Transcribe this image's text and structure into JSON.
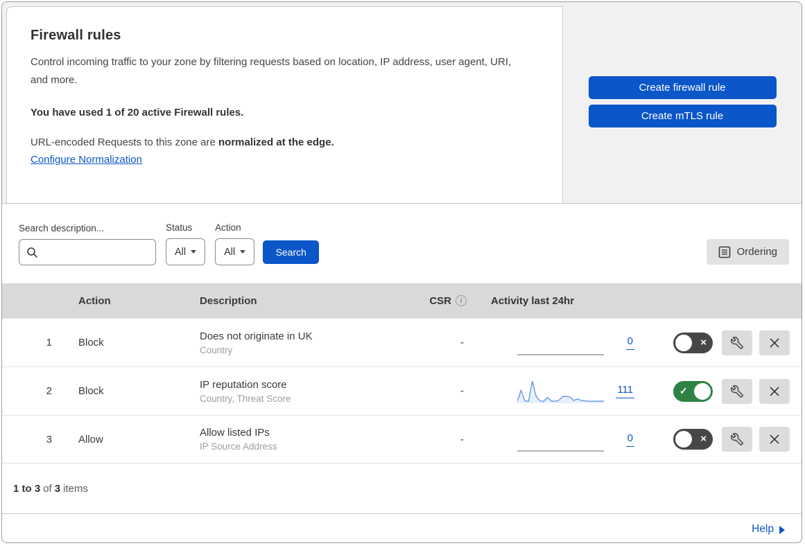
{
  "header": {
    "title": "Firewall rules",
    "description": "Control incoming traffic to your zone by filtering requests based on location, IP address, user agent, URI, and more.",
    "usage": "You have used 1 of 20 active Firewall rules.",
    "normalization_prefix": "URL-encoded Requests to this zone are ",
    "normalization_bold": "normalized at the edge.",
    "configure_link": "Configure Normalization",
    "create_firewall_btn": "Create firewall rule",
    "create_mtls_btn": "Create mTLS rule"
  },
  "filters": {
    "search_label": "Search description...",
    "search_value": "",
    "status_label": "Status",
    "status_value": "All",
    "action_label": "Action",
    "action_value": "All",
    "search_btn": "Search",
    "ordering_btn": "Ordering"
  },
  "table": {
    "columns": {
      "action": "Action",
      "description": "Description",
      "csr": "CSR",
      "activity": "Activity last 24hr"
    },
    "rows": [
      {
        "priority": "1",
        "action": "Block",
        "description": "Does not originate in UK",
        "criteria": "Country",
        "csr": "-",
        "activity_count": "0",
        "enabled": false
      },
      {
        "priority": "2",
        "action": "Block",
        "description": "IP reputation score",
        "criteria": "Country, Threat Score",
        "csr": "-",
        "activity_count": "111",
        "enabled": true
      },
      {
        "priority": "3",
        "action": "Allow",
        "description": "Allow listed IPs",
        "criteria": "IP Source Address",
        "csr": "-",
        "activity_count": "0",
        "enabled": false
      }
    ],
    "pagination": {
      "range": "1 to 3",
      "of_word": "of",
      "total": "3",
      "items_word": "items"
    }
  },
  "help": {
    "label": "Help"
  },
  "toggle_glyphs": {
    "on": "✓",
    "off": "×"
  },
  "chart_data": [
    {
      "type": "line",
      "row": 1,
      "label": "Activity last 24hr",
      "total": 0,
      "values": [
        0,
        0,
        0,
        0,
        0,
        0,
        0,
        0,
        0,
        0,
        0,
        0,
        0,
        0,
        0,
        0,
        0,
        0,
        0,
        0,
        0,
        0,
        0,
        0
      ]
    },
    {
      "type": "line",
      "row": 2,
      "label": "Activity last 24hr",
      "total": 111,
      "values": [
        8,
        55,
        10,
        8,
        95,
        30,
        10,
        8,
        25,
        10,
        8,
        12,
        28,
        30,
        26,
        12,
        18,
        12,
        10,
        8,
        8,
        8,
        9,
        8
      ]
    },
    {
      "type": "line",
      "row": 3,
      "label": "Activity last 24hr",
      "total": 0,
      "values": [
        0,
        0,
        0,
        0,
        0,
        0,
        0,
        0,
        0,
        0,
        0,
        0,
        0,
        0,
        0,
        0,
        0,
        0,
        0,
        0,
        0,
        0,
        0,
        0
      ]
    }
  ],
  "colors": {
    "accent_blue": "#0b56c8",
    "toggle_on_green": "#2e8243",
    "toggle_off_gray": "#474747",
    "sparkline_blue": "#6d9eea",
    "sparkline_fill": "#e9f0fb",
    "flat_line_gray": "#9a9a9a",
    "header_gray": "#d9d9d9",
    "panel_gray": "#f1f1f1"
  }
}
